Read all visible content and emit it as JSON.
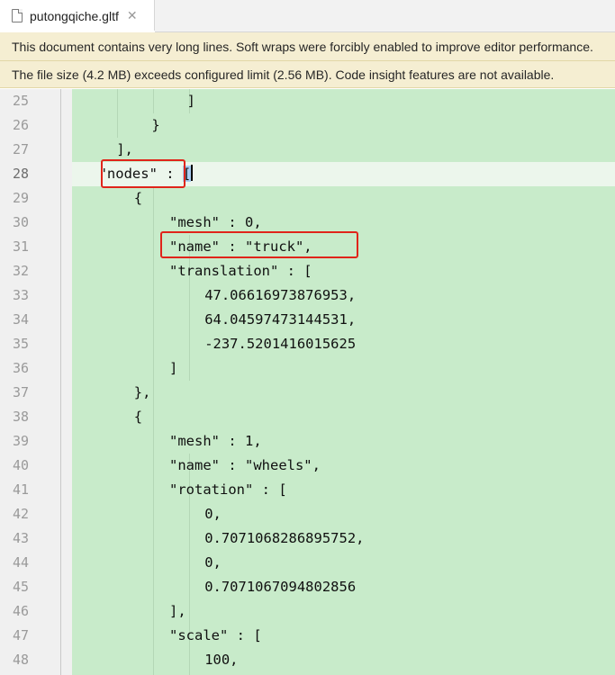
{
  "tab": {
    "title": "putongqiche.gltf",
    "close_glyph": "✕"
  },
  "banners": [
    "This document contains very long lines. Soft wraps were forcibly enabled to improve editor performance.",
    "The file size (4.2 MB) exceeds configured limit (2.56 MB). Code insight features are not available."
  ],
  "editor": {
    "current_line": 28,
    "lines": [
      {
        "num": "25",
        "indent": 6,
        "text": "]"
      },
      {
        "num": "26",
        "indent": 4,
        "text": "}"
      },
      {
        "num": "27",
        "indent": 2,
        "text": "],"
      },
      {
        "num": "28",
        "indent": 1,
        "text": "\"nodes\" : "
      },
      {
        "num": "29",
        "indent": 3,
        "text": "{"
      },
      {
        "num": "30",
        "indent": 5,
        "text": "\"mesh\" : 0,"
      },
      {
        "num": "31",
        "indent": 5,
        "text": "\"name\" : \"truck\","
      },
      {
        "num": "32",
        "indent": 5,
        "text": "\"translation\" : ["
      },
      {
        "num": "33",
        "indent": 7,
        "text": "47.06616973876953,"
      },
      {
        "num": "34",
        "indent": 7,
        "text": "64.04597473144531,"
      },
      {
        "num": "35",
        "indent": 7,
        "text": "-237.5201416015625"
      },
      {
        "num": "36",
        "indent": 5,
        "text": "]"
      },
      {
        "num": "37",
        "indent": 3,
        "text": "},"
      },
      {
        "num": "38",
        "indent": 3,
        "text": "{"
      },
      {
        "num": "39",
        "indent": 5,
        "text": "\"mesh\" : 1,"
      },
      {
        "num": "40",
        "indent": 5,
        "text": "\"name\" : \"wheels\","
      },
      {
        "num": "41",
        "indent": 5,
        "text": "\"rotation\" : ["
      },
      {
        "num": "42",
        "indent": 7,
        "text": "0,"
      },
      {
        "num": "43",
        "indent": 7,
        "text": "0.7071068286895752,"
      },
      {
        "num": "44",
        "indent": 7,
        "text": "0,"
      },
      {
        "num": "45",
        "indent": 7,
        "text": "0.7071067094802856"
      },
      {
        "num": "46",
        "indent": 5,
        "text": "],"
      },
      {
        "num": "47",
        "indent": 5,
        "text": "\"scale\" : ["
      },
      {
        "num": "48",
        "indent": 7,
        "text": "100,"
      }
    ],
    "line28_bracket": "[",
    "colors": {
      "code_background": "#c8ebca",
      "current_line": "#ecf6ec",
      "gutter": "#f0f0f0",
      "banner": "#f5eed2",
      "annotation_red": "#e0241a",
      "bracket_highlight": "#a9cdf2"
    }
  },
  "annotations": [
    {
      "label": "nodes-key-highlight"
    },
    {
      "label": "name-truck-highlight"
    }
  ]
}
